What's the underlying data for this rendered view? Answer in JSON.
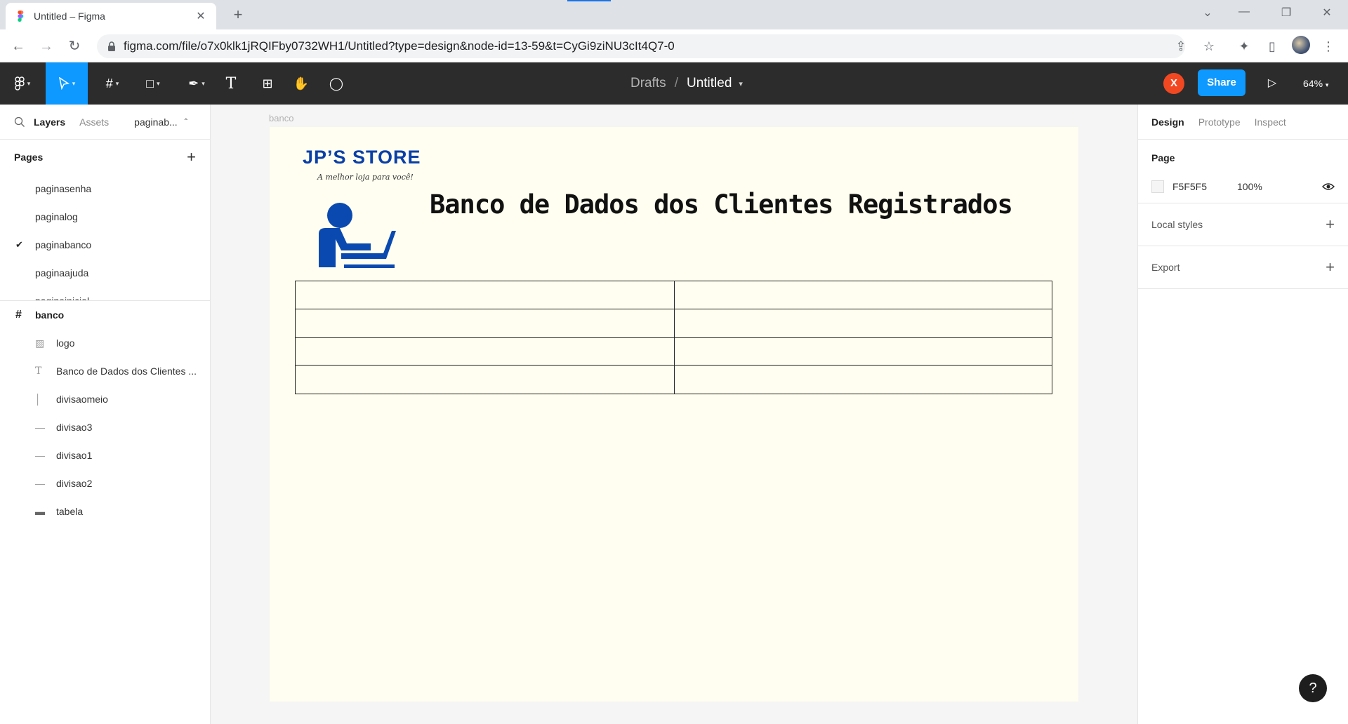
{
  "browser": {
    "tab_title": "Untitled – Figma",
    "url": "figma.com/file/o7x0klk1jRQIFby0732WH1/Untitled?type=design&node-id=13-59&t=CyGi9ziNU3cIt4Q7-0"
  },
  "toolbar": {
    "breadcrumb_drafts": "Drafts",
    "breadcrumb_sep": "/",
    "file_name": "Untitled",
    "user_initial": "X",
    "share_label": "Share",
    "zoom_label": "64%"
  },
  "left_panel": {
    "tab_layers": "Layers",
    "tab_assets": "Assets",
    "current_page_short": "paginab...",
    "pages_title": "Pages",
    "pages": [
      {
        "name": "paginasenha",
        "selected": false
      },
      {
        "name": "paginalog",
        "selected": false
      },
      {
        "name": "paginabanco",
        "selected": true
      },
      {
        "name": "paginaajuda",
        "selected": false
      },
      {
        "name": "paginainicial",
        "selected": false
      }
    ],
    "frame_name": "banco",
    "layers": [
      {
        "name": "logo",
        "icon": "image-icon"
      },
      {
        "name": "Banco de Dados dos Clientes ...",
        "icon": "text-icon"
      },
      {
        "name": "divisaomeio",
        "icon": "vertical-line-icon"
      },
      {
        "name": "divisao3",
        "icon": "line-icon"
      },
      {
        "name": "divisao1",
        "icon": "line-icon"
      },
      {
        "name": "divisao2",
        "icon": "line-icon"
      },
      {
        "name": "tabela",
        "icon": "rectangle-icon"
      }
    ]
  },
  "canvas": {
    "frame_label": "banco",
    "brand": "JP’S STORE",
    "tagline": "A melhor loja para você!",
    "title": "Banco de Dados dos Clientes Registrados",
    "frame_color": "#fffef0",
    "brand_color": "#0a3fa8"
  },
  "right_panel": {
    "tab_design": "Design",
    "tab_prototype": "Prototype",
    "tab_inspect": "Inspect",
    "page_title": "Page",
    "page_color": "F5F5F5",
    "page_opacity": "100%",
    "local_styles": "Local styles",
    "export": "Export"
  },
  "help_label": "?"
}
